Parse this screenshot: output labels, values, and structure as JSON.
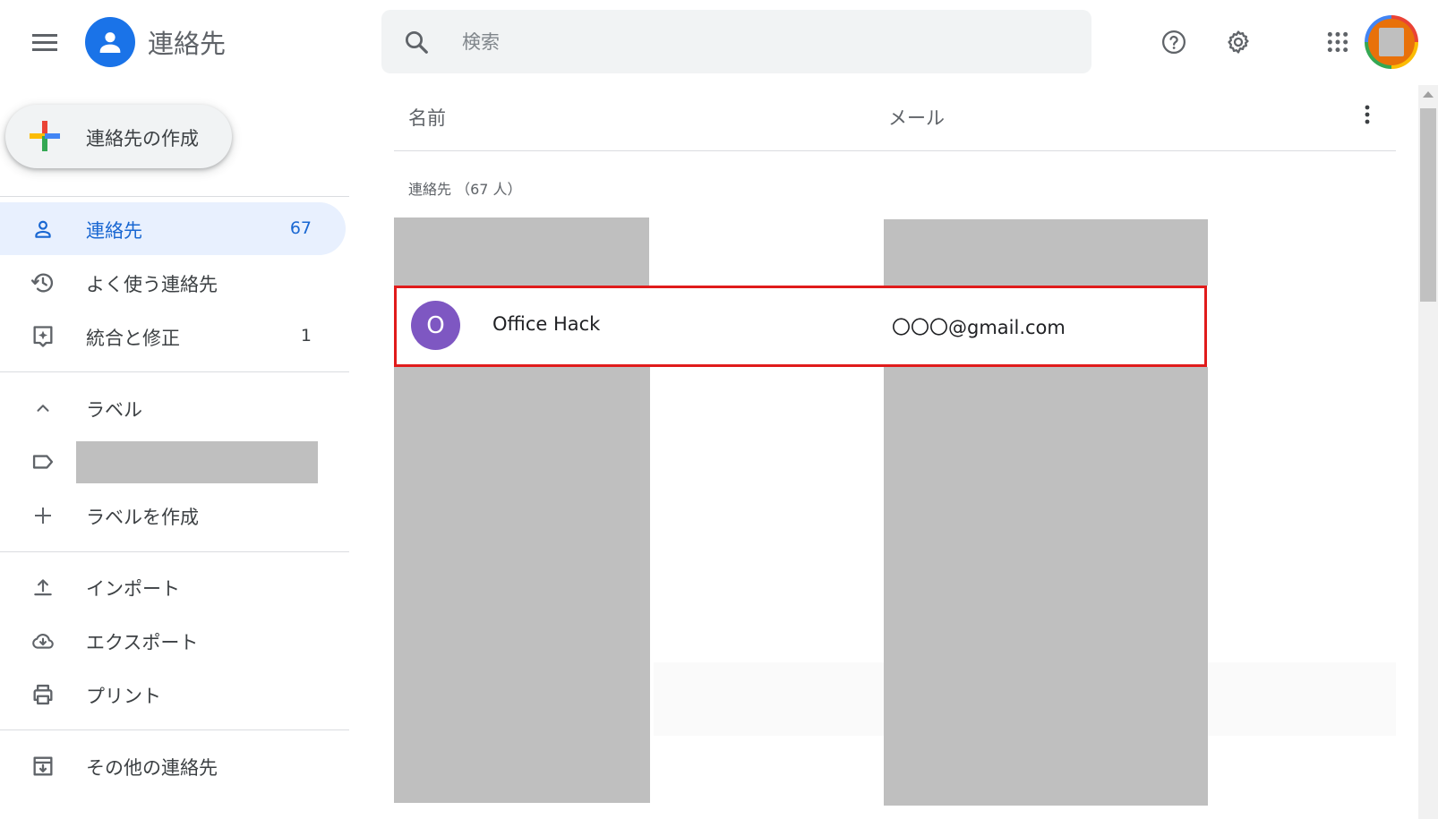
{
  "app": {
    "title": "連絡先"
  },
  "search": {
    "placeholder": "検索"
  },
  "header_icons": [
    "menu-icon",
    "search-icon",
    "help-icon",
    "settings-icon",
    "apps-icon",
    "account-avatar"
  ],
  "create_button": {
    "label": "連絡先の作成"
  },
  "sidebar": {
    "items": [
      {
        "label": "連絡先",
        "count": "67",
        "icon": "person-icon",
        "active": true
      },
      {
        "label": "よく使う連絡先",
        "count": "",
        "icon": "history-icon",
        "active": false
      },
      {
        "label": "統合と修正",
        "count": "1",
        "icon": "merge-fix-icon",
        "active": false
      }
    ],
    "labels_section": {
      "header": "ラベル",
      "create_label": "ラベルを作成"
    },
    "tools": [
      {
        "label": "インポート",
        "icon": "upload-icon"
      },
      {
        "label": "エクスポート",
        "icon": "cloud-download-icon"
      },
      {
        "label": "プリント",
        "icon": "print-icon"
      }
    ],
    "other_contacts": {
      "label": "その他の連絡先",
      "icon": "archive-icon"
    }
  },
  "main": {
    "columns": {
      "name": "名前",
      "email": "メール"
    },
    "section_label": "連絡先 （67 人）",
    "contacts": [
      {
        "initial": "O",
        "name": "Office Hack",
        "email": "〇〇〇@gmail.com",
        "avatar_color": "#7e57c2",
        "highlighted": true
      }
    ]
  },
  "colors": {
    "accent": "#1a73e8",
    "active_nav_bg": "#e8f0fe",
    "highlight_border": "#e01b1b",
    "redaction": "#bfbfbf"
  }
}
